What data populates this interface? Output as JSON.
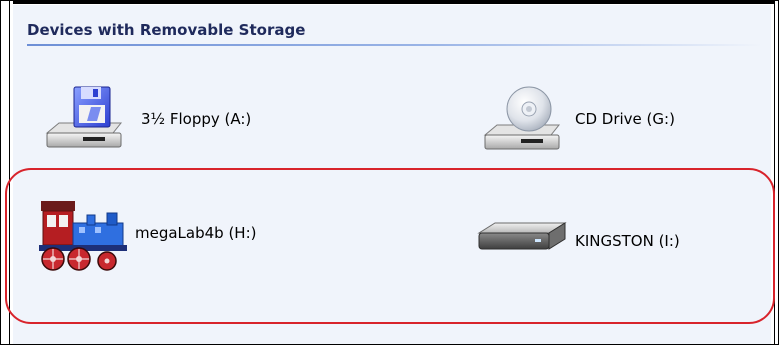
{
  "section": {
    "header": "Devices with Removable Storage"
  },
  "devices": [
    {
      "label": "3½ Floppy (A:)",
      "icon": "floppy-drive-icon"
    },
    {
      "label": "CD Drive (G:)",
      "icon": "cd-drive-icon"
    },
    {
      "label": "megaLab4b (H:)",
      "icon": "train-drive-icon"
    },
    {
      "label": "KINGSTON (I:)",
      "icon": "removable-disk-icon"
    }
  ],
  "annotation": {
    "highlight_color": "#d8232b"
  }
}
